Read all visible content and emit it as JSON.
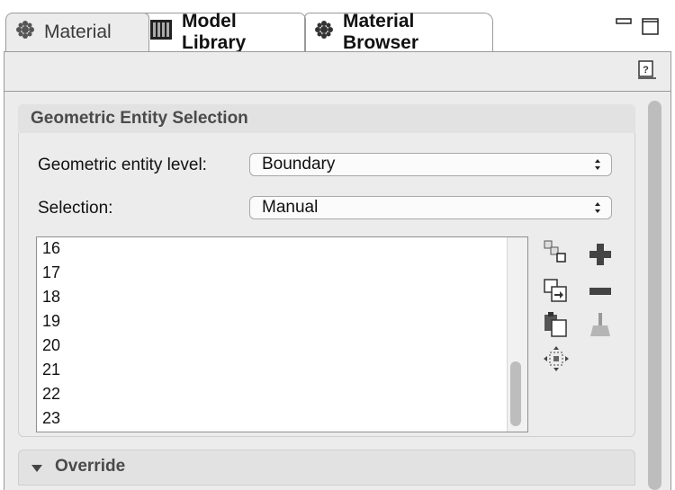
{
  "tabs": [
    {
      "label": "Material",
      "icon": "material-icon"
    },
    {
      "label": "Model Library",
      "icon": "model-library-icon"
    },
    {
      "label": "Material Browser",
      "icon": "material-icon"
    }
  ],
  "section": {
    "title": "Geometric Entity Selection",
    "entity_level_label": "Geometric entity level:",
    "entity_level_value": "Boundary",
    "selection_label": "Selection:",
    "selection_value": "Manual",
    "items": [
      "16",
      "17",
      "18",
      "19",
      "20",
      "21",
      "22",
      "23"
    ]
  },
  "override": {
    "title": "Override"
  },
  "icons": [
    "help-icon",
    "minimize-icon",
    "maximize-icon",
    "copy-selection-icon",
    "paste-selection-icon",
    "clear-selection-icon",
    "zoom-to-selection-icon",
    "add-icon",
    "remove-icon",
    "sweep-icon",
    "expand-arrow-icon"
  ]
}
